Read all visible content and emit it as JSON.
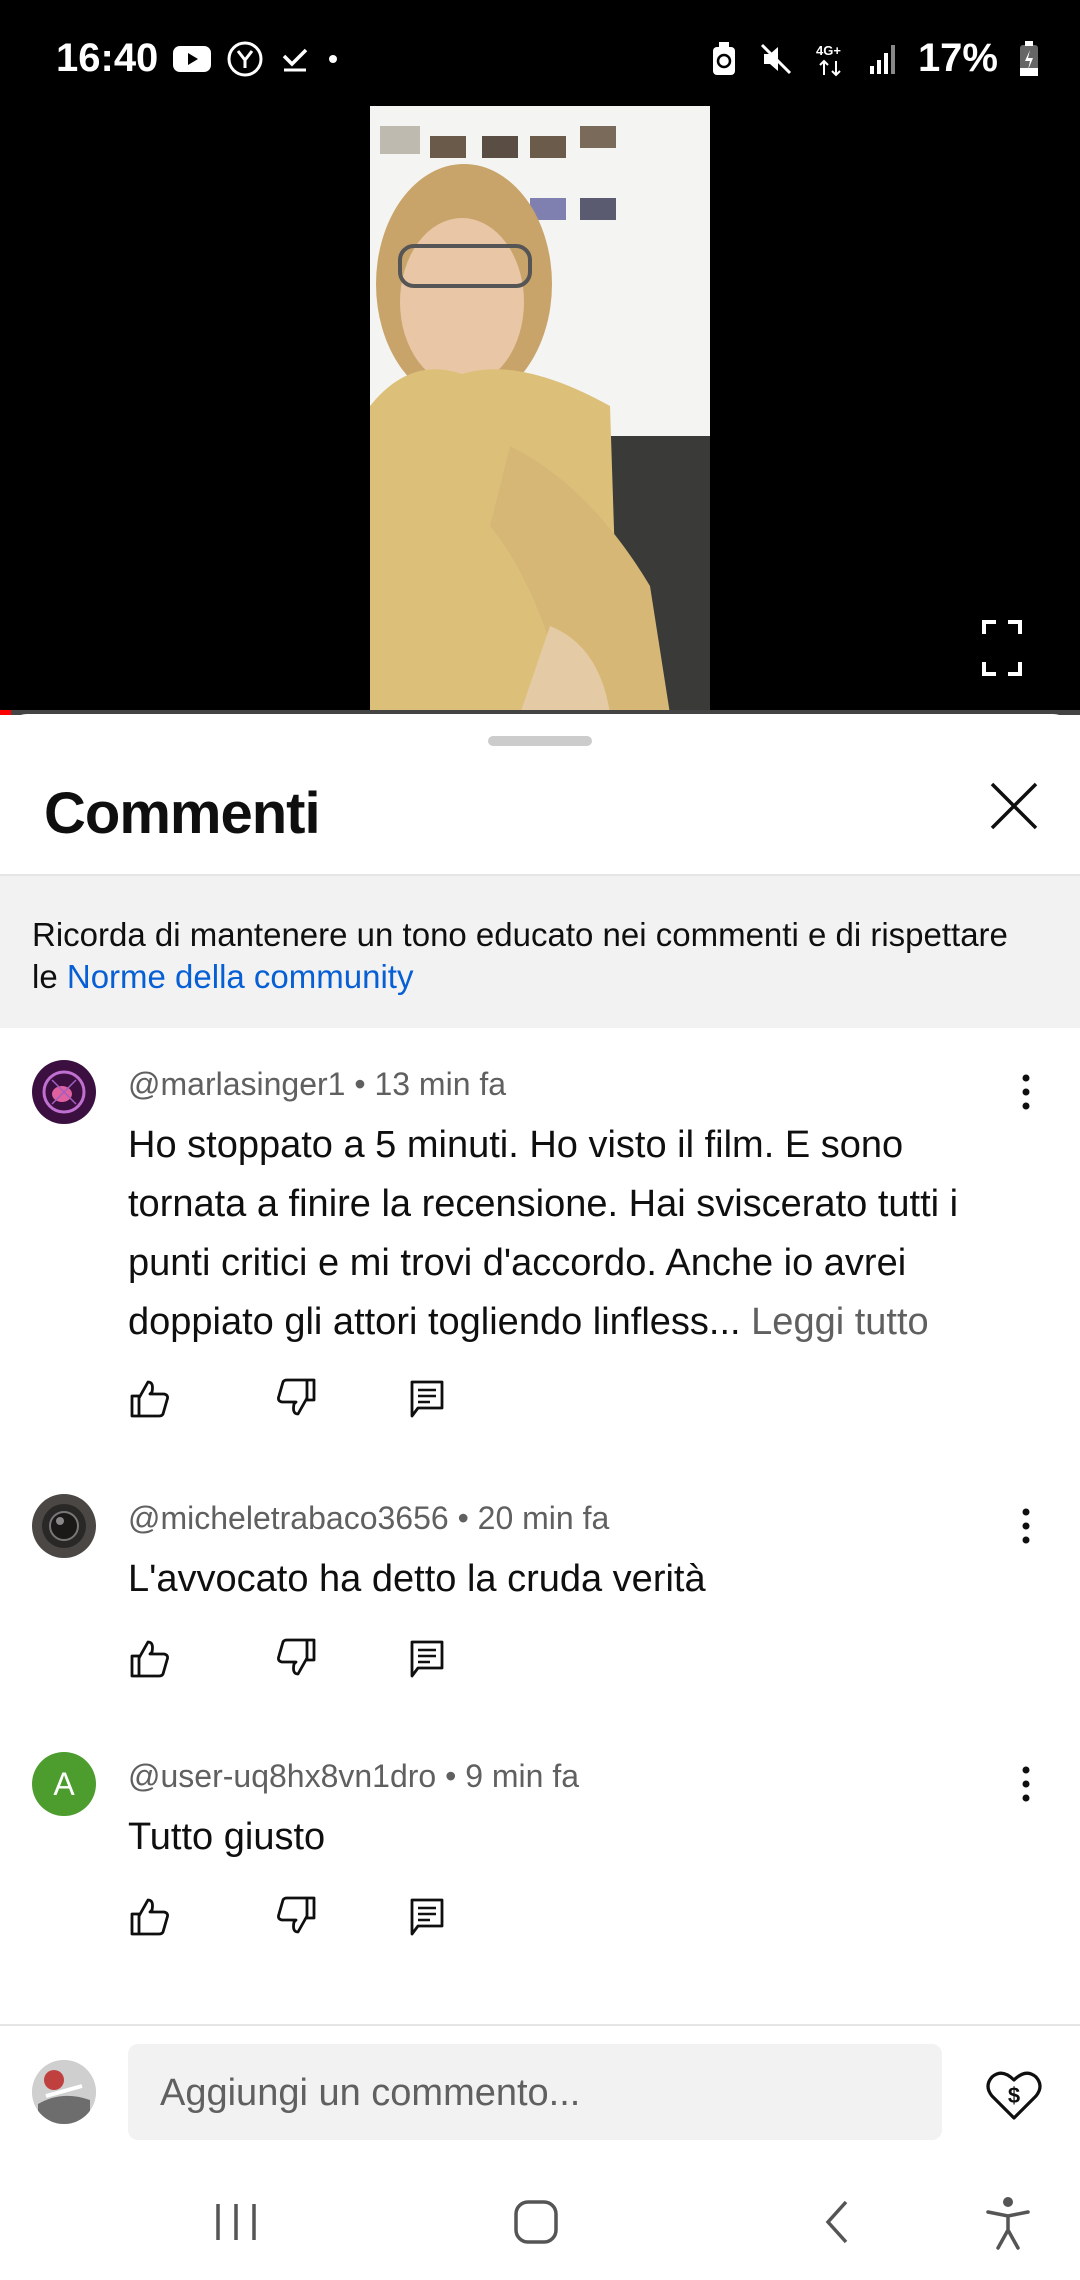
{
  "status_bar": {
    "time": "16:40",
    "battery": "17%",
    "network": "4G+"
  },
  "player": {
    "progress_fraction": 0.01
  },
  "comments_sheet": {
    "title": "Commenti",
    "notice_text": "Ricorda di mantenere un tono educato nei commenti e di rispettare le ",
    "notice_link": "Norme della community"
  },
  "comments": [
    {
      "author": "@marlasinger1",
      "time": "13 min fa",
      "text": "Ho stoppato a 5 minuti. Ho visto il film. E sono tornata a finire la recensione. Hai sviscerato tutti i punti critici e mi trovi d'accordo. Anche io avrei doppiato gli attori togliendo linfless...",
      "read_more": "Leggi tutto"
    },
    {
      "author": "@micheletrabaco3656",
      "time": "20 min fa",
      "text": "L'avvocato ha detto la cruda verità"
    },
    {
      "author": "@user-uq8hx8vn1dro",
      "time": "9 min fa",
      "text": "Tutto giusto",
      "avatar_letter": "A"
    }
  ],
  "composer": {
    "placeholder": "Aggiungi un commento..."
  },
  "colors": {
    "link": "#065fd4",
    "progress": "#ff0000",
    "avatar_green": "#4c9c2e"
  }
}
